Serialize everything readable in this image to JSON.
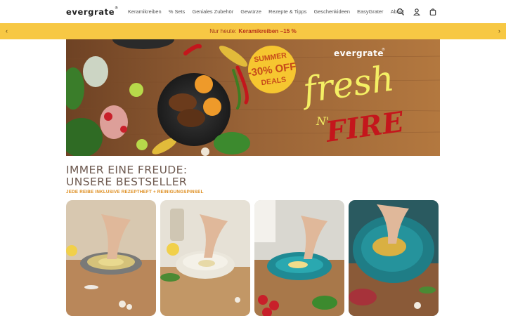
{
  "header": {
    "logo": "evergrate",
    "logo_mark": "®",
    "nav": [
      "Keramikreiben",
      "% Sets",
      "Geniales Zubehör",
      "Gewürze",
      "Rezepte & Tipps",
      "Geschenkideen",
      "EasyGrater",
      "About"
    ],
    "icons": [
      "search-icon",
      "user-icon",
      "cart-icon"
    ]
  },
  "promo": {
    "prefix": "Nur heute:",
    "highlight": "Keramikreiben –15 %",
    "prev_icon": "chevron-left-icon",
    "next_icon": "chevron-right-icon"
  },
  "hero": {
    "badge_line1": "SUMMER",
    "badge_line2": "-30% OFF",
    "badge_line3": "DEALS",
    "brand": "evergrate",
    "brand_mark": "®",
    "script_fresh": "fresh",
    "script_n": "N'",
    "script_fire": "FIRE"
  },
  "section": {
    "title_line1": "IMMER EINE FREUDE:",
    "title_line2": "UNSERE BESTSELLER",
    "subtitle": "JEDE REIBE INKLUSIVE REZEPTHEFT + REINIGUNGSPINSEL"
  },
  "colors": {
    "promo_bg": "#f7c844",
    "accent_orange": "#dd8a18",
    "badge_yellow": "#f6c630",
    "neon_yellow": "#f4ef64",
    "fire_red": "#c4161c"
  }
}
